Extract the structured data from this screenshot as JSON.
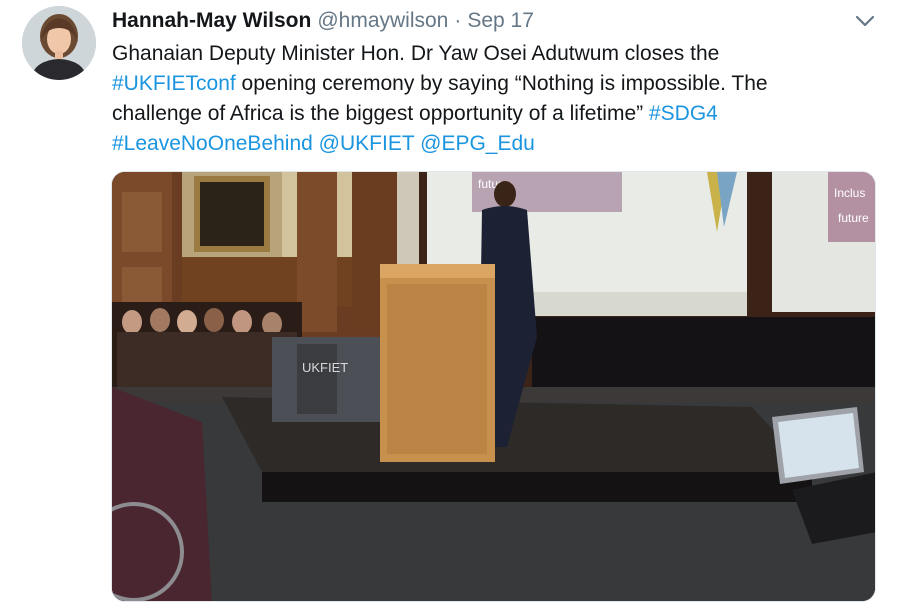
{
  "author": {
    "name": "Hannah-May Wilson",
    "handle": "@hmaywilson",
    "separator": "·",
    "time": "Sep 17"
  },
  "tweet": {
    "t1": "Ghanaian Deputy Minister Hon. Dr Yaw Osei Adutwum closes the",
    "tag_ukfietconf": "#UKFIETconf",
    "t2": " opening ceremony by saying “Nothing is impossible. The challenge of Africa is the biggest opportunity of a lifetime” ",
    "tag_sdg4": "#SDG4",
    "tag_leavenoone": "#LeaveNoOneBehind",
    "mention_ukfiet": "@UKFIET",
    "mention_epg": "@EPG_Edu"
  },
  "media": {
    "table_banner": "UKFIET",
    "screen_left_text": "future",
    "screen_right_text": "Inclus",
    "screen_right_text2": "future"
  },
  "icons": {
    "caret": "chevron-down-icon"
  },
  "colors": {
    "link": "#1b95e0",
    "secondary": "#657786",
    "text": "#14171a"
  }
}
